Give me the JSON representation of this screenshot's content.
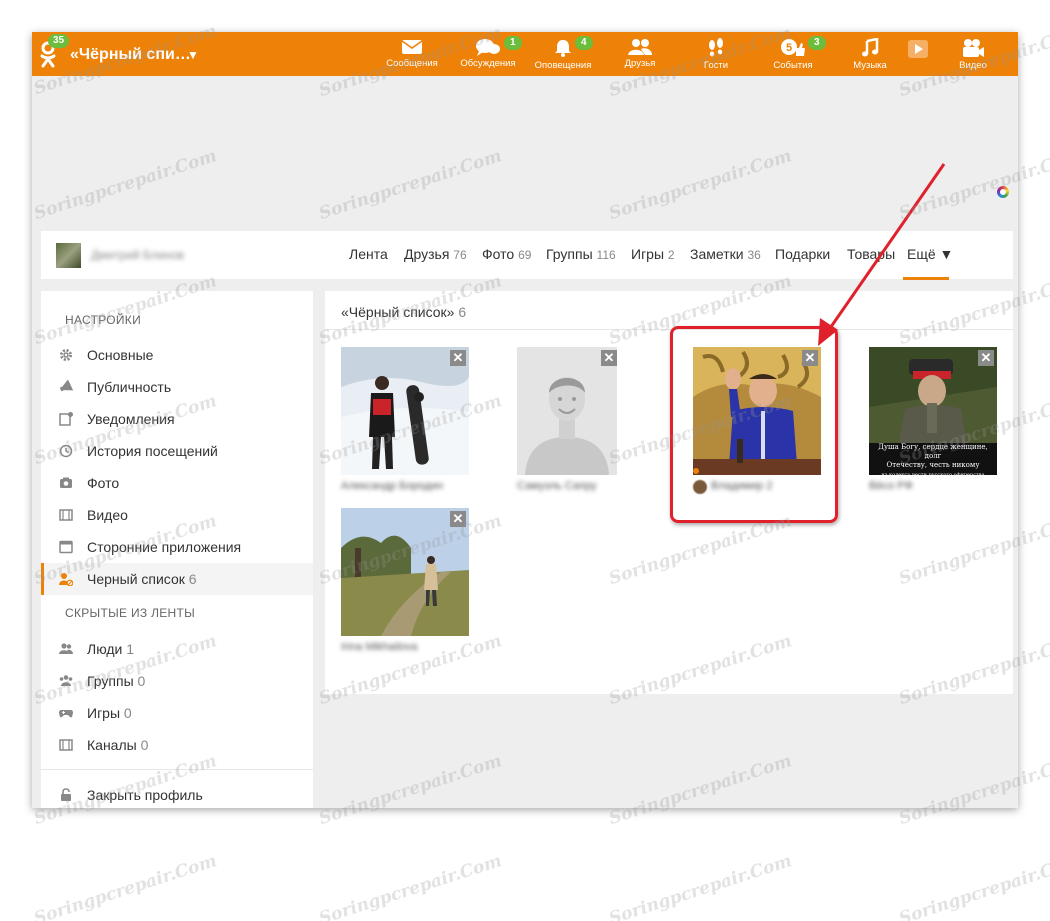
{
  "topbar": {
    "logo_badge": "35",
    "page_title": "«Чёрный спи…",
    "nav": [
      {
        "label": "Сообщения",
        "icon": "envelope-icon",
        "badge": ""
      },
      {
        "label": "Обсуждения",
        "icon": "chat-bubbles-icon",
        "badge": "1"
      },
      {
        "label": "Оповещения",
        "icon": "bell-icon",
        "badge": "4"
      },
      {
        "label": "Друзья",
        "icon": "friends-icon",
        "badge": ""
      },
      {
        "label": "Гости",
        "icon": "footprints-icon",
        "badge": ""
      },
      {
        "label": "События",
        "icon": "like-icon",
        "badge": "3"
      },
      {
        "label": "Музыка",
        "icon": "music-note-icon",
        "badge": ""
      },
      {
        "label": "Видео",
        "icon": "camera-icon",
        "badge": ""
      }
    ]
  },
  "profile": {
    "name": "Дмитрий Блинов",
    "tabs": [
      {
        "label": "Лента",
        "count": ""
      },
      {
        "label": "Друзья",
        "count": "76"
      },
      {
        "label": "Фото",
        "count": "69"
      },
      {
        "label": "Группы",
        "count": "116"
      },
      {
        "label": "Игры",
        "count": "2"
      },
      {
        "label": "Заметки",
        "count": "36"
      },
      {
        "label": "Подарки",
        "count": ""
      },
      {
        "label": "Товары",
        "count": ""
      },
      {
        "label": "Ещё ▼",
        "count": ""
      }
    ]
  },
  "sidebar": {
    "settings_heading": "НАСТРОЙКИ",
    "settings_items": [
      {
        "label": "Основные",
        "count": "",
        "icon": "gear-icon"
      },
      {
        "label": "Публичность",
        "count": "",
        "icon": "megaphone-icon"
      },
      {
        "label": "Уведомления",
        "count": "",
        "icon": "notification-icon"
      },
      {
        "label": "История посещений",
        "count": "",
        "icon": "history-icon"
      },
      {
        "label": "Фото",
        "count": "",
        "icon": "photo-camera-icon"
      },
      {
        "label": "Видео",
        "count": "",
        "icon": "film-icon"
      },
      {
        "label": "Сторонние приложения",
        "count": "",
        "icon": "app-window-icon"
      },
      {
        "label": "Черный список",
        "count": "6",
        "icon": "blocked-user-icon"
      }
    ],
    "hidden_heading": "СКРЫТЫЕ ИЗ ЛЕНТЫ",
    "hidden_items": [
      {
        "label": "Люди",
        "count": "1",
        "icon": "people-icon"
      },
      {
        "label": "Группы",
        "count": "0",
        "icon": "groups-icon"
      },
      {
        "label": "Игры",
        "count": "0",
        "icon": "gamepad-icon"
      },
      {
        "label": "Каналы",
        "count": "0",
        "icon": "channel-icon"
      }
    ],
    "close_profile": "Закрыть профиль"
  },
  "content": {
    "title": "«Чёрный список»",
    "count": "6",
    "people": [
      {
        "name": "Александр Бородин"
      },
      {
        "name": "Самуэль Сапру"
      },
      {
        "name": "Владимир 2"
      },
      {
        "name": "Вёсо РФ"
      },
      {
        "name": "Irina Mikhailova"
      }
    ]
  },
  "watermark": "Soringpcrepair.Com",
  "colors": {
    "accent": "#ee8208",
    "badge": "#6bbd3b",
    "annotation": "#e0212b"
  }
}
